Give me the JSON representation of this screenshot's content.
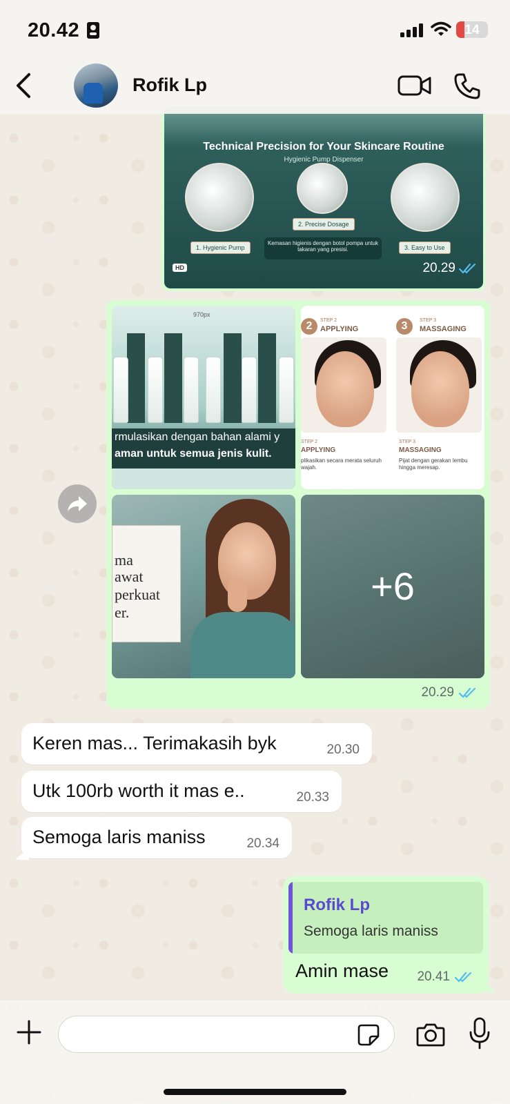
{
  "status_bar": {
    "time": "20.42",
    "battery": "14"
  },
  "header": {
    "contact_name": "Rofik Lp"
  },
  "messages": [
    {
      "type": "outgoing_image",
      "image": {
        "title": "Technical Precision for Your Skincare Routine",
        "subtitle": "Hygienic Pump Dispenser",
        "labels": [
          "1. Hygienic Pump",
          "2. Precise Dosage",
          "3. Easy to Use"
        ],
        "caption": "Kemasan higienis dengan botol pompa untuk takaran yang presisi.",
        "hd_badge": "HD"
      },
      "time": "20.29"
    },
    {
      "type": "outgoing_album",
      "tiles": {
        "tile1": {
          "top_label": "970px",
          "line1": "rmulasikan dengan bahan alami y",
          "line2": "aman untuk semua jenis kulit."
        },
        "tile2": {
          "step2_small": "STEP 2",
          "step2_title": "APPLYING",
          "step2_num": "2",
          "step3_small": "STEP 3",
          "step3_title": "MASSAGING",
          "step3_num": "3",
          "step2_bottom_small": "STEP 2",
          "step2_bottom_title": "APPLYING",
          "step2_desc": "plikasikan secara merata seluruh wajah.",
          "step3_bottom_small": "STEP 3",
          "step3_bottom_title": "MASSAGING",
          "step3_desc": "Pijat dengan gerakan lembu hingga meresap."
        },
        "tile3": {
          "lines": [
            "ma",
            "awat",
            "perkuat",
            "er."
          ]
        },
        "tile4": {
          "more_count": "+6"
        }
      },
      "time": "20.29"
    },
    {
      "type": "incoming",
      "text": "Keren mas... Terimakasih byk",
      "time": "20.30"
    },
    {
      "type": "incoming",
      "text": "Utk 100rb worth it mas e..",
      "time": "20.33"
    },
    {
      "type": "incoming",
      "text": "Semoga laris maniss",
      "time": "20.34"
    },
    {
      "type": "outgoing_reply",
      "quote": {
        "name": "Rofik Lp",
        "text": "Semoga laris maniss"
      },
      "text": "Amin mase",
      "time": "20.41"
    }
  ],
  "input": {
    "placeholder": ""
  },
  "colors": {
    "outgoing_bubble": "#d9fdd3",
    "incoming_bubble": "#ffffff",
    "read_check": "#53bdeb",
    "quote_accent": "#6e55d8"
  },
  "icons": [
    "back-chevron-icon",
    "video-call-icon",
    "phone-icon",
    "forward-icon",
    "plus-icon",
    "sticker-icon",
    "camera-icon",
    "microphone-icon",
    "double-check-icon",
    "id-card-icon",
    "signal-icon",
    "wifi-icon",
    "battery-icon"
  ]
}
